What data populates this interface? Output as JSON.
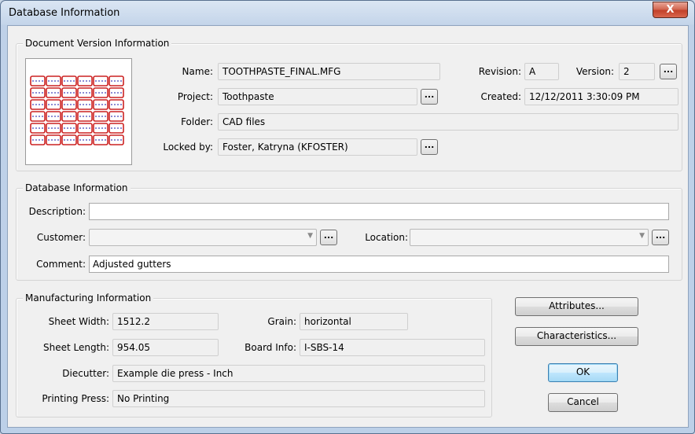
{
  "window": {
    "title": "Database Information",
    "close_glyph": "X"
  },
  "doc_version": {
    "group_title": "Document Version Information",
    "name_label": "Name:",
    "name": "TOOTHPASTE_FINAL.MFG",
    "project_label": "Project:",
    "project": "Toothpaste",
    "folder_label": "Folder:",
    "folder": "CAD files",
    "locked_label": "Locked by:",
    "locked_by": "Foster, Katryna (KFOSTER)",
    "revision_label": "Revision:",
    "revision": "A",
    "version_label": "Version:",
    "version": "2",
    "created_label": "Created:",
    "created": "12/12/2011 3:30:09 PM"
  },
  "db_info": {
    "group_title": "Database Information",
    "description_label": "Description:",
    "description": "",
    "customer_label": "Customer:",
    "customer": "",
    "location_label": "Location:",
    "location": "",
    "comment_label": "Comment:",
    "comment": "Adjusted gutters"
  },
  "mfg_info": {
    "group_title": "Manufacturing Information",
    "sheet_width_label": "Sheet Width:",
    "sheet_width": "1512.2",
    "sheet_length_label": "Sheet Length:",
    "sheet_length": "954.05",
    "grain_label": "Grain:",
    "grain": "horizontal",
    "board_label": "Board Info:",
    "board_info": "I-SBS-14",
    "diecutter_label": "Diecutter:",
    "diecutter": "Example die press - Inch",
    "press_label": "Printing Press:",
    "printing_press": "No Printing"
  },
  "buttons": {
    "browse": "...",
    "attributes": "Attributes...",
    "characteristics": "Characteristics...",
    "ok": "OK",
    "cancel": "Cancel"
  },
  "colors": {
    "thumb_lines": "#cc2222",
    "thumb_dashes": "#1a1aa8",
    "close_button": "#c2412a"
  }
}
